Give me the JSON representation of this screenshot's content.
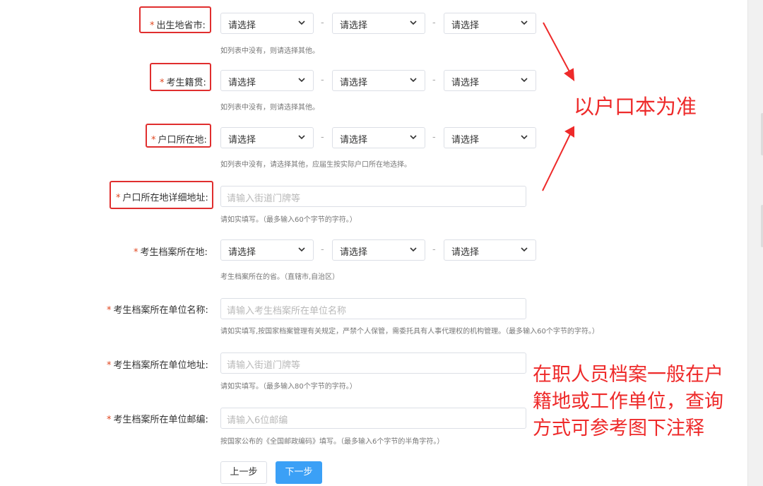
{
  "form": {
    "required_mark": "*",
    "rows": {
      "birth": {
        "label": "出生地省市:",
        "select1": "请选择",
        "select2": "请选择",
        "select3": "请选择",
        "hint": "如列表中没有，则请选择其他。"
      },
      "native": {
        "label": "考生籍贯:",
        "select1": "请选择",
        "select2": "请选择",
        "select3": "请选择",
        "hint": "如列表中没有，则请选择其他。"
      },
      "hukou": {
        "label": "户口所在地:",
        "select1": "请选择",
        "select2": "请选择",
        "select3": "请选择",
        "hint": "如列表中没有，请选择其他，应届生按实际户口所在地选择。"
      },
      "hukou_detail": {
        "label": "户口所在地详细地址:",
        "placeholder": "请输入街道门牌等",
        "hint": "请如实填写。（最多输入60个字节的字符。）"
      },
      "archive_loc": {
        "label": "考生档案所在地:",
        "select1": "请选择",
        "select2": "请选择",
        "select3": "请选择",
        "hint": "考生档案所在的省。（直辖市,自治区）"
      },
      "archive_unit_name": {
        "label": "考生档案所在单位名称:",
        "placeholder": "请输入考生档案所在单位名称",
        "hint": "请如实填写,按国家档案管理有关规定，严禁个人保管，需委托具有人事代理权的机构管理。（最多输入60个字节的字符。）"
      },
      "archive_unit_addr": {
        "label": "考生档案所在单位地址:",
        "placeholder": "请输入街道门牌等",
        "hint": "请如实填写。（最多输入80个字节的字符。）"
      },
      "archive_unit_zip": {
        "label": "考生档案所在单位邮编:",
        "placeholder": "请输入6位邮编",
        "hint": "按国家公布的《全国邮政编码》填写。（最多输入6个字节的半角字符。）"
      }
    },
    "separator": "-",
    "buttons": {
      "prev": "上一步",
      "next": "下一步"
    }
  },
  "annotations": {
    "hukou_note": "以户口本为准",
    "archive_note_line1": "在职人员档案一般在户",
    "archive_note_line2": "籍地或工作单位，查询",
    "archive_note_line3": "方式可参考图下注释",
    "color": "#ee2a2a"
  },
  "colors": {
    "primary_button": "#3ba0f6",
    "required_star": "#e0461f",
    "border": "#dcdfe6"
  }
}
